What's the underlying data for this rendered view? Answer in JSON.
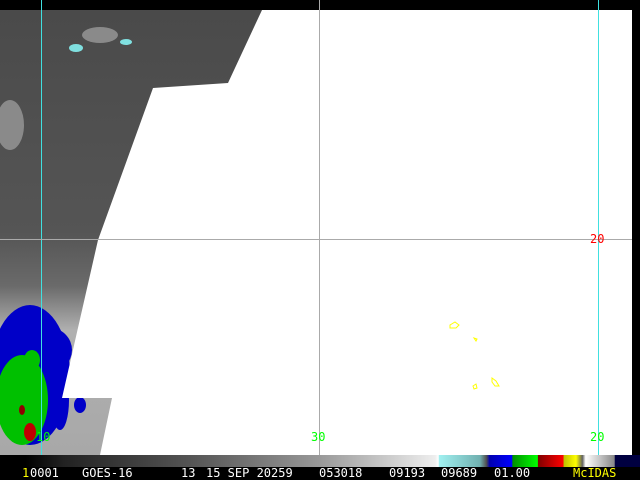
{
  "image": {
    "satellite": "GOES-16",
    "grid_labels": {
      "lat_right": "20",
      "lon_bottom_center": "30",
      "lon_bottom_right": "20",
      "lon_bottom_left": "10"
    },
    "colors": {
      "grid": "#40e0e0",
      "lat_label": "#ff0000",
      "lon_label": "#00ff00",
      "outline": "#ffff00",
      "missing": "#ffffff"
    }
  },
  "status_bar": {
    "frame_prefix": "1",
    "frame": "0001",
    "satellite": "GOES-16",
    "band": "13",
    "date": "15 SEP 20259",
    "time": "053018",
    "line": "09193",
    "element": "09689",
    "resolution": "01.00",
    "brand": "McIDAS"
  }
}
